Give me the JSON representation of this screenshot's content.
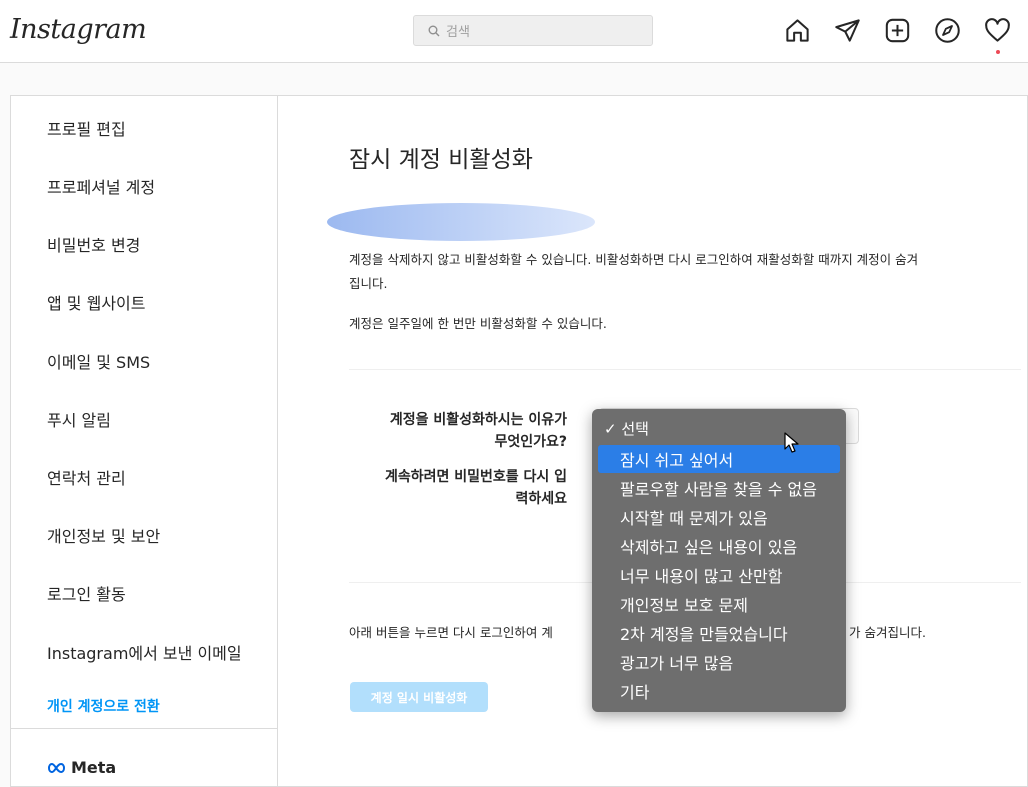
{
  "header": {
    "logo": "Instagram",
    "search_placeholder": "검색",
    "icons": [
      "home-icon",
      "send-icon",
      "new-post-icon",
      "explore-icon",
      "heart-icon"
    ]
  },
  "sidebar": {
    "items": [
      {
        "label": "프로필 편집"
      },
      {
        "label": "프로페셔널 계정"
      },
      {
        "label": "비밀번호 변경"
      },
      {
        "label": "앱 및 웹사이트"
      },
      {
        "label": "이메일 및 SMS"
      },
      {
        "label": "푸시 알림"
      },
      {
        "label": "연락처 관리"
      },
      {
        "label": "개인정보 및 보안"
      },
      {
        "label": "로그인 활동"
      },
      {
        "label": "Instagram에서 보낸 이메일"
      },
      {
        "label": "개인 계정으로 전환"
      }
    ],
    "footer": "Meta"
  },
  "main": {
    "title": "잠시 계정 비활성화",
    "desc1_line1": "계정을 삭제하지 않고 비활성화할 수 있습니다. 비활성화하면 다시 로그인하여 재활성화할 때까지 계정이 숨겨",
    "desc1_line2": "집니다.",
    "desc2": "계정은 일주일에 한 번만 비활성화할 수 있습니다.",
    "reason_label_1": "계정을 비활성화하시는 이유가",
    "reason_label_2": "무엇인가요?",
    "password_label_1": "계속하려면 비밀번호를 다시 입",
    "password_label_2": "력하세요",
    "bottom_text_left": "아래 버튼을 누르면 다시 로그인하여 계",
    "bottom_text_right": "가 숨겨집니다.",
    "deactivate_button": "계정 일시 비활성화"
  },
  "dropdown": {
    "header": "✓ 선택",
    "selected": "잠시 쉬고 싶어서",
    "options": [
      "잠시 쉬고 싶어서",
      "팔로우할 사람을 찾을 수 없음",
      "시작할 때 문제가 있음",
      "삭제하고 싶은 내용이 있음",
      "너무 내용이 많고 산만함",
      "개인정보 보호 문제",
      "2차 계정을 만들었습니다",
      "광고가 너무 많음",
      "기타"
    ]
  },
  "colors": {
    "link_blue": "#0095f6",
    "button_disabled": "#b2dffc",
    "menu_bg": "#6e6e6e",
    "menu_selected": "#2b7ee7"
  }
}
